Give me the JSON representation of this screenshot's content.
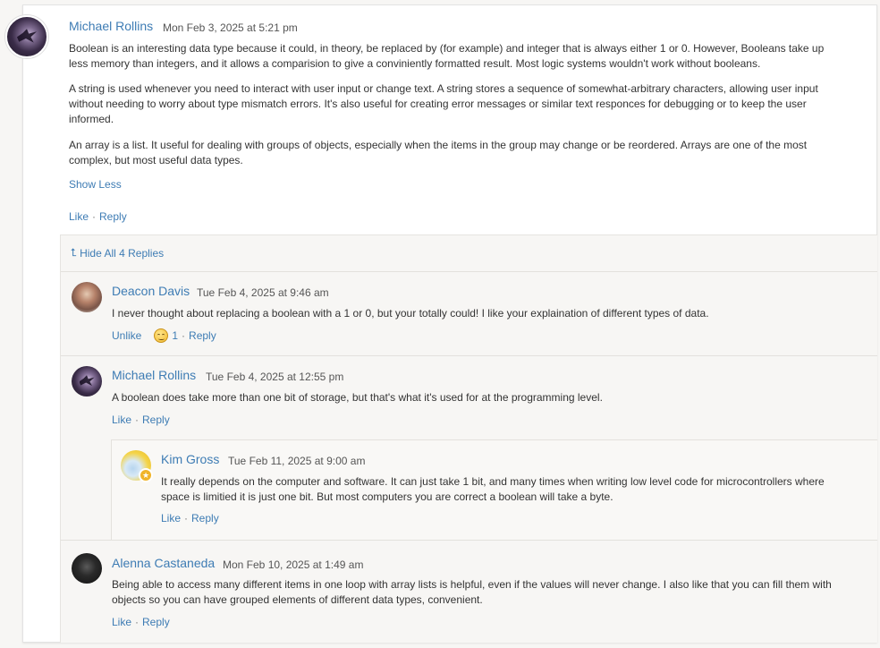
{
  "post": {
    "author": "Michael Rollins",
    "timestamp": "Mon Feb 3, 2025 at 5:21 pm",
    "paragraphs": [
      "Boolean is an interesting data type because it could, in theory, be replaced by (for example) and integer that is always either 1 or 0. However, Booleans take up less memory than integers, and it allows a comparision to give a conviniently formatted result. Most logic systems wouldn't work without booleans.",
      "A string is used whenever you need to interact with user input or change text. A string stores a sequence of somewhat-arbitrary characters, allowing user input without needing to worry about type mismatch errors. It's also useful for creating error messages or similar text responces for debugging or to keep the user informed.",
      "An array is a list. It useful for dealing with groups of objects, especially when the items in the group may change or be reordered. Arrays are one of the most complex, but most useful data types."
    ],
    "show_less": "Show Less",
    "like": "Like",
    "reply": "Reply"
  },
  "replies_toggle": "Hide All 4 Replies",
  "replies": [
    {
      "author": "Deacon Davis",
      "timestamp": "Tue Feb 4, 2025 at 9:46 am",
      "text": "I never thought about replacing a boolean with a 1 or 0, but your totally could! I like your explaination of different types of data.",
      "like": "Unlike",
      "like_count": "1",
      "reply": "Reply"
    },
    {
      "author": "Michael Rollins",
      "timestamp": "Tue Feb 4, 2025 at 12:55 pm",
      "text": "A boolean does take more than one bit of storage, but that's what it's used for at the programming level.",
      "like": "Like",
      "reply": "Reply"
    },
    {
      "author": "Kim Gross",
      "timestamp": "Tue Feb 11, 2025 at 9:00 am",
      "text": "It really depends on the computer and software.  It can just take 1 bit, and many times when writing low level code for microcontrollers where space is limitied it is just one bit.    But most computers you are correct a boolean will take a byte.",
      "like": "Like",
      "reply": "Reply"
    },
    {
      "author": "Alenna Castaneda",
      "timestamp": "Mon Feb 10, 2025 at 1:49 am",
      "text": "Being able to access many different items in one loop with array lists is helpful, even if the values will never change. I also like that you can fill them with objects so you can have grouped elements of different data types, convenient.",
      "like": "Like",
      "reply": "Reply"
    }
  ],
  "colors": {
    "link": "#3e7cb4",
    "panel": "#f7f6f4"
  }
}
